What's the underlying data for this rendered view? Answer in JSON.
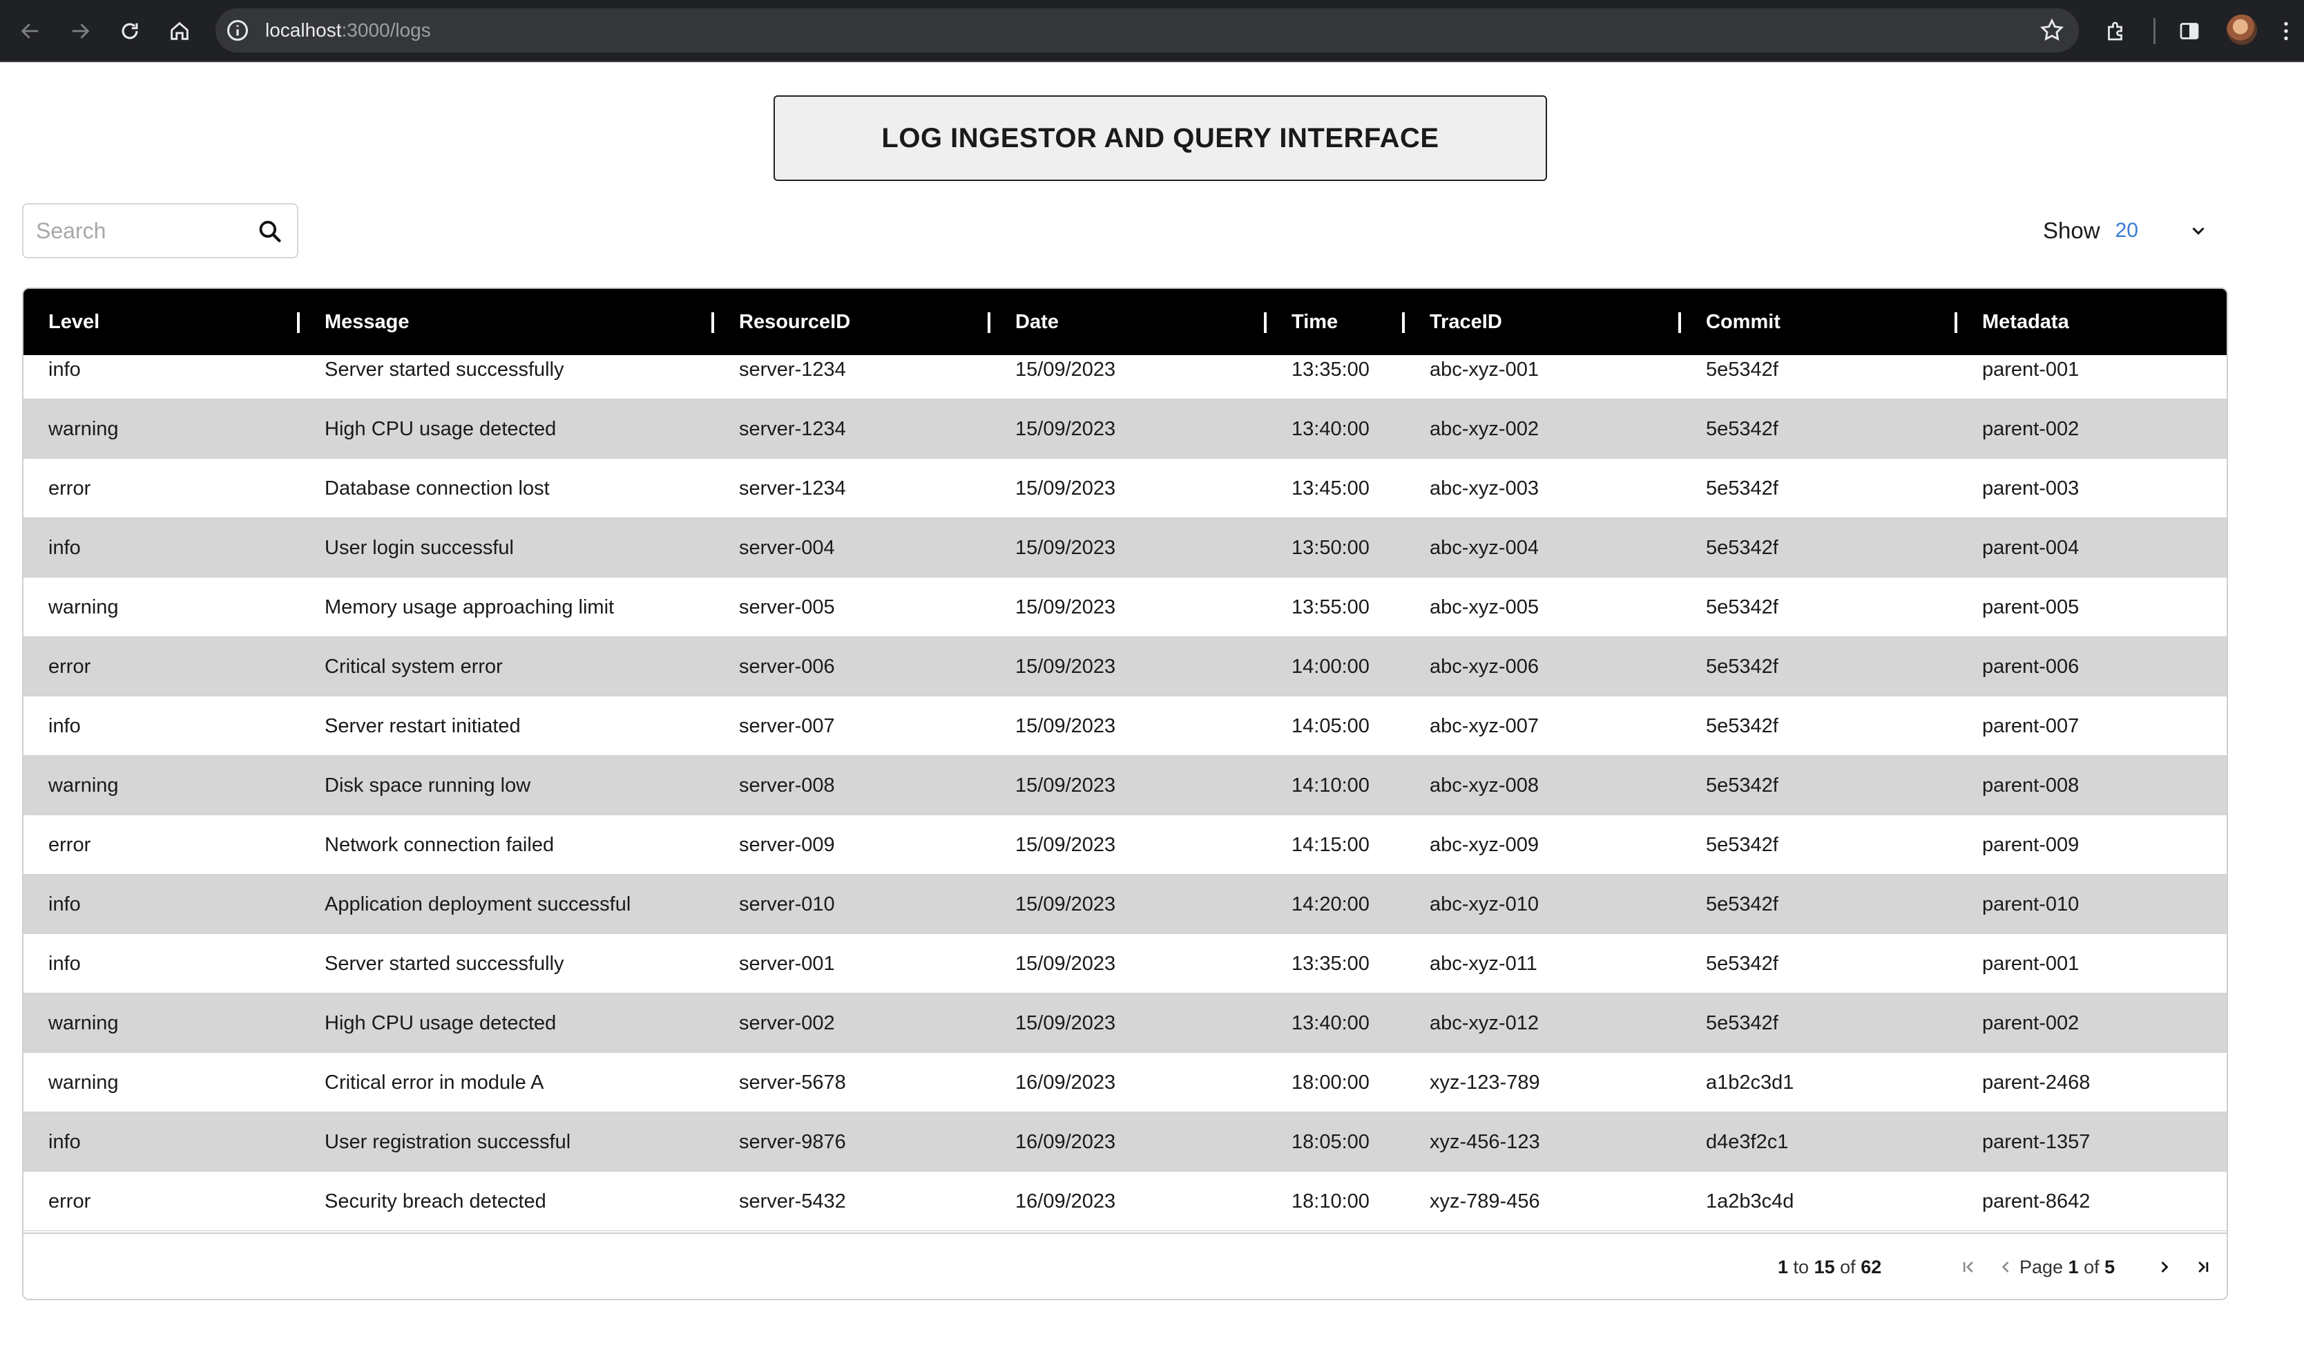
{
  "browser": {
    "url_host": "localhost",
    "url_rest": ":3000/logs"
  },
  "app": {
    "title": "LOG INGESTOR AND QUERY INTERFACE",
    "search_placeholder": "Search",
    "show_label": "Show",
    "show_value": "20"
  },
  "table": {
    "headers": [
      "Level",
      "Message",
      "ResourceID",
      "Date",
      "Time",
      "TraceID",
      "Commit",
      "Metadata"
    ],
    "rows": [
      [
        "info",
        "Server started successfully",
        "server-1234",
        "15/09/2023",
        "13:35:00",
        "abc-xyz-001",
        "5e5342f",
        "parent-001"
      ],
      [
        "warning",
        "High CPU usage detected",
        "server-1234",
        "15/09/2023",
        "13:40:00",
        "abc-xyz-002",
        "5e5342f",
        "parent-002"
      ],
      [
        "error",
        "Database connection lost",
        "server-1234",
        "15/09/2023",
        "13:45:00",
        "abc-xyz-003",
        "5e5342f",
        "parent-003"
      ],
      [
        "info",
        "User login successful",
        "server-004",
        "15/09/2023",
        "13:50:00",
        "abc-xyz-004",
        "5e5342f",
        "parent-004"
      ],
      [
        "warning",
        "Memory usage approaching limit",
        "server-005",
        "15/09/2023",
        "13:55:00",
        "abc-xyz-005",
        "5e5342f",
        "parent-005"
      ],
      [
        "error",
        "Critical system error",
        "server-006",
        "15/09/2023",
        "14:00:00",
        "abc-xyz-006",
        "5e5342f",
        "parent-006"
      ],
      [
        "info",
        "Server restart initiated",
        "server-007",
        "15/09/2023",
        "14:05:00",
        "abc-xyz-007",
        "5e5342f",
        "parent-007"
      ],
      [
        "warning",
        "Disk space running low",
        "server-008",
        "15/09/2023",
        "14:10:00",
        "abc-xyz-008",
        "5e5342f",
        "parent-008"
      ],
      [
        "error",
        "Network connection failed",
        "server-009",
        "15/09/2023",
        "14:15:00",
        "abc-xyz-009",
        "5e5342f",
        "parent-009"
      ],
      [
        "info",
        "Application deployment successful",
        "server-010",
        "15/09/2023",
        "14:20:00",
        "abc-xyz-010",
        "5e5342f",
        "parent-010"
      ],
      [
        "info",
        "Server started successfully",
        "server-001",
        "15/09/2023",
        "13:35:00",
        "abc-xyz-011",
        "5e5342f",
        "parent-001"
      ],
      [
        "warning",
        "High CPU usage detected",
        "server-002",
        "15/09/2023",
        "13:40:00",
        "abc-xyz-012",
        "5e5342f",
        "parent-002"
      ],
      [
        "warning",
        "Critical error in module A",
        "server-5678",
        "16/09/2023",
        "18:00:00",
        "xyz-123-789",
        "a1b2c3d1",
        "parent-2468"
      ],
      [
        "info",
        "User registration successful",
        "server-9876",
        "16/09/2023",
        "18:05:00",
        "xyz-456-123",
        "d4e3f2c1",
        "parent-1357"
      ],
      [
        "error",
        "Security breach detected",
        "server-5432",
        "16/09/2023",
        "18:10:00",
        "xyz-789-456",
        "1a2b3c4d",
        "parent-8642"
      ]
    ]
  },
  "pagination": {
    "from": "1",
    "to_word": "to",
    "to": "15",
    "of_word": "of",
    "total": "62",
    "page_word": "Page",
    "page": "1",
    "pages_of_word": "of",
    "pages": "5"
  }
}
